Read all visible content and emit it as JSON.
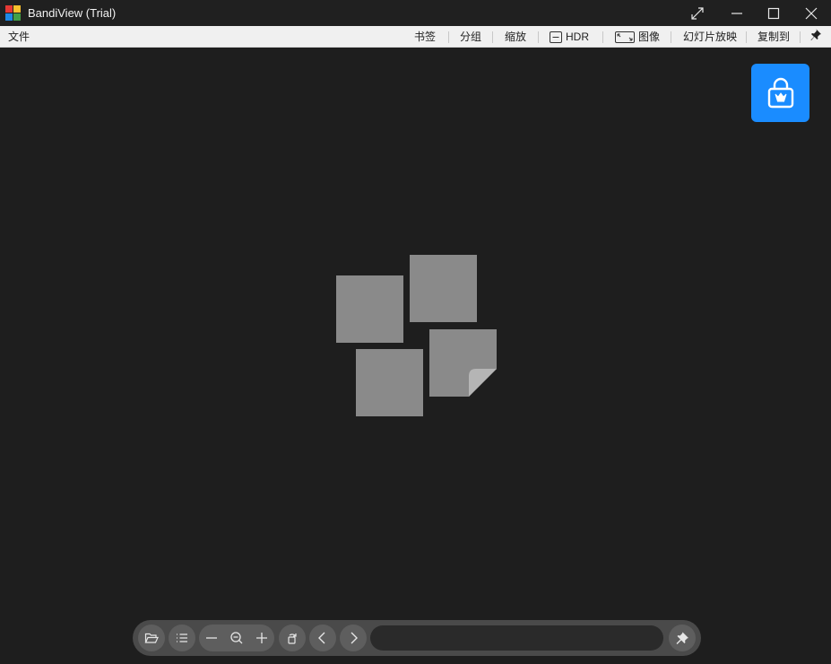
{
  "window": {
    "title": "BandiView (Trial)"
  },
  "menubar": {
    "file": "文件",
    "bookmark": "书签",
    "group": "分组",
    "zoom": "缩放",
    "hdr": "HDR",
    "image": "图像",
    "slideshow": "幻灯片放映",
    "copy_to": "复制到"
  },
  "toolbar": {
    "path_value": "",
    "path_placeholder": ""
  },
  "colors": {
    "accent": "#1a8cff",
    "background": "#1e1e1e",
    "placeholder_tile": "#8a8a8a"
  },
  "icons": [
    "app-logo-icon",
    "fullscreen-icon",
    "minimize-icon",
    "maximize-icon",
    "close-icon",
    "hdr-icon",
    "image-icon",
    "pin-icon",
    "store-lock-icon",
    "folder-open-icon",
    "list-icon",
    "zoom-out-icon",
    "zoom-fit-icon",
    "zoom-in-icon",
    "rotate-icon",
    "prev-icon",
    "next-icon"
  ]
}
